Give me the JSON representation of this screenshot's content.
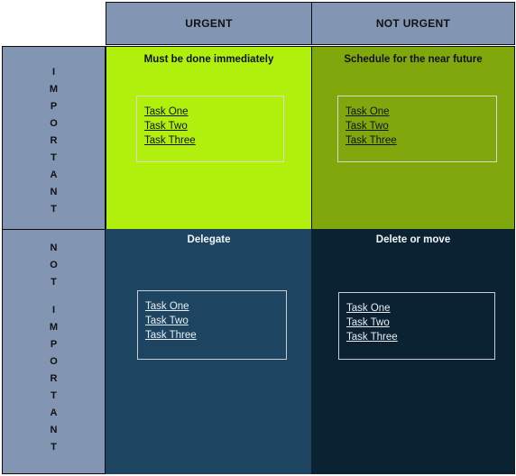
{
  "columns": [
    {
      "label": "URGENT"
    },
    {
      "label": "NOT URGENT"
    }
  ],
  "rows": [
    {
      "label": "IMPORTANT",
      "letters": [
        "I",
        "M",
        "P",
        "O",
        "R",
        "T",
        "A",
        "N",
        "T"
      ]
    },
    {
      "label": "NOT IMPORTANT",
      "letters": [
        "N",
        "O",
        "T",
        "",
        "I",
        "M",
        "P",
        "O",
        "R",
        "T",
        "A",
        "N",
        "T"
      ]
    }
  ],
  "quadrants": {
    "do": {
      "title": "Must be done immediately",
      "background": "#b0f00c",
      "tasks": [
        "Task One",
        "Task Two",
        "Task Three"
      ]
    },
    "schedule": {
      "title": "Schedule for the near future",
      "background": "#80a80c",
      "tasks": [
        "Task One",
        "Task Two",
        "Task Three"
      ]
    },
    "delegate": {
      "title": "Delegate",
      "background": "#1d4561",
      "tasks": [
        "Task One",
        "Task Two",
        "Task Three"
      ]
    },
    "delete": {
      "title": "Delete or move",
      "background": "#0a2232",
      "tasks": [
        "Task One",
        "Task Two",
        "Task Three"
      ]
    }
  },
  "colors": {
    "header": "#8296b4",
    "border": "#0c0c0c",
    "box_border_light": "#d8d8d0",
    "text_dark": "#111111",
    "text_light": "#f2f6f8"
  }
}
